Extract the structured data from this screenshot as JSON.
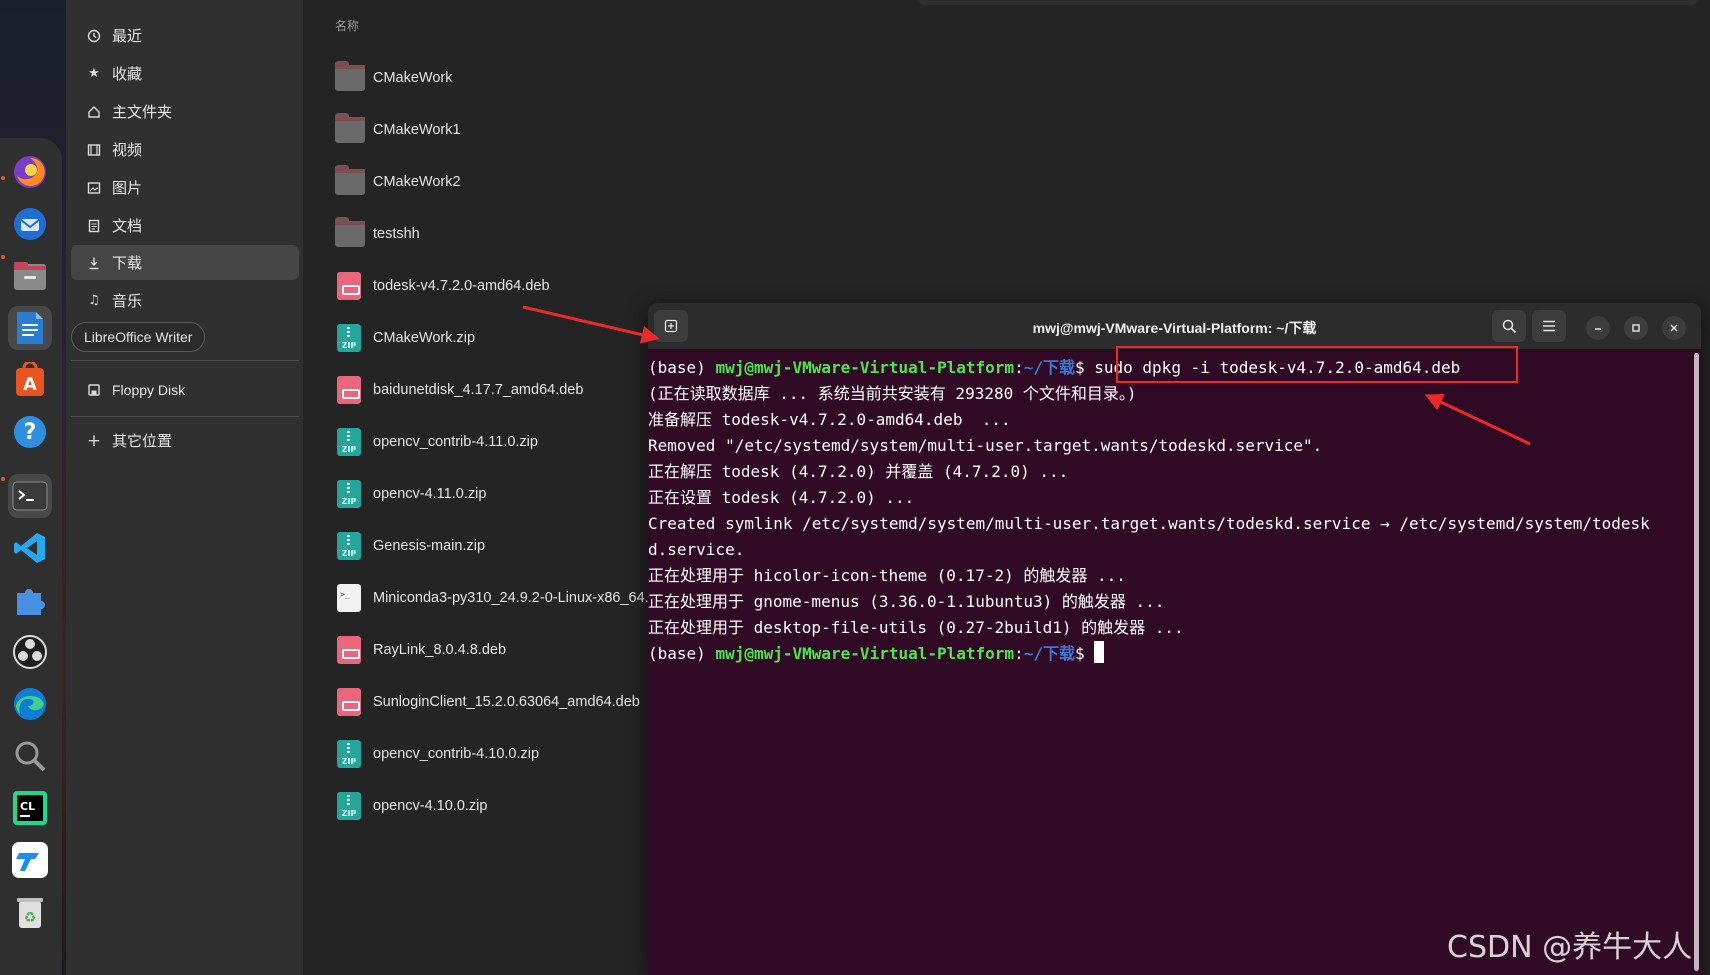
{
  "dock": {
    "apps": [
      {
        "name": "firefox",
        "icon": "firefox-icon"
      },
      {
        "name": "thunderbird",
        "icon": "thunderbird-icon"
      },
      {
        "name": "files",
        "icon": "files-icon"
      },
      {
        "name": "libreoffice-writer",
        "icon": "writer-icon"
      },
      {
        "name": "app-center",
        "icon": "app-center-icon"
      },
      {
        "name": "help",
        "icon": "help-icon"
      },
      {
        "name": "terminal",
        "icon": "terminal-icon"
      },
      {
        "name": "vscode",
        "icon": "vscode-icon"
      },
      {
        "name": "extensions",
        "icon": "puzzle-icon"
      },
      {
        "name": "obs",
        "icon": "obs-icon"
      },
      {
        "name": "edge",
        "icon": "edge-icon"
      },
      {
        "name": "search",
        "icon": "magnifier-icon"
      },
      {
        "name": "clion",
        "icon": "clion-icon"
      },
      {
        "name": "todesk",
        "icon": "todesk-icon"
      },
      {
        "name": "trash",
        "icon": "trash-icon"
      }
    ]
  },
  "sidebar": {
    "items": [
      {
        "label": "最近",
        "icon": "clock-icon"
      },
      {
        "label": "收藏",
        "icon": "star-icon"
      },
      {
        "label": "主文件夹",
        "icon": "home-icon"
      },
      {
        "label": "视频",
        "icon": "film-icon"
      },
      {
        "label": "图片",
        "icon": "image-icon"
      },
      {
        "label": "文档",
        "icon": "document-icon"
      },
      {
        "label": "下载",
        "icon": "download-icon"
      },
      {
        "label": "音乐",
        "icon": "music-icon"
      }
    ],
    "tooltip": "LibreOffice Writer",
    "devices": [
      {
        "label": "Floppy Disk",
        "icon": "floppy-icon"
      }
    ],
    "other": {
      "label": "其它位置",
      "icon": "plus-icon"
    }
  },
  "filelist": {
    "column_header": "名称",
    "files": [
      {
        "name": "CMakeWork",
        "type": "folder"
      },
      {
        "name": "CMakeWork1",
        "type": "folder"
      },
      {
        "name": "CMakeWork2",
        "type": "folder"
      },
      {
        "name": "testshh",
        "type": "folder"
      },
      {
        "name": "todesk-v4.7.2.0-amd64.deb",
        "type": "deb"
      },
      {
        "name": "CMakeWork.zip",
        "type": "zip"
      },
      {
        "name": "baidunetdisk_4.17.7_amd64.deb",
        "type": "deb"
      },
      {
        "name": "opencv_contrib-4.11.0.zip",
        "type": "zip"
      },
      {
        "name": "opencv-4.11.0.zip",
        "type": "zip"
      },
      {
        "name": "Genesis-main.zip",
        "type": "zip"
      },
      {
        "name": "Miniconda3-py310_24.9.2-0-Linux-x86_64.",
        "type": "sh"
      },
      {
        "name": "RayLink_8.0.4.8.deb",
        "type": "deb"
      },
      {
        "name": "SunloginClient_15.2.0.63064_amd64.deb",
        "type": "deb"
      },
      {
        "name": "opencv_contrib-4.10.0.zip",
        "type": "zip"
      },
      {
        "name": "opencv-4.10.0.zip",
        "type": "zip"
      }
    ],
    "zip_badge": "ZIP"
  },
  "terminal": {
    "title": "mwj@mwj-VMware-Virtual-Platform: ~/下载",
    "prompt": {
      "env": "(base) ",
      "user_host": "mwj@mwj-VMware-Virtual-Platform",
      "sep": ":",
      "path": "~/下载",
      "dollar": "$ "
    },
    "command": "sudo dpkg -i todesk-v4.7.2.0-amd64.deb",
    "output": [
      "(正在读取数据库 ... 系统当前共安装有 293280 个文件和目录。)",
      "准备解压 todesk-v4.7.2.0-amd64.deb  ...",
      "Removed \"/etc/systemd/system/multi-user.target.wants/todeskd.service\".",
      "正在解压 todesk (4.7.2.0) 并覆盖 (4.7.2.0) ...",
      "正在设置 todesk (4.7.2.0) ...",
      "Created symlink /etc/systemd/system/multi-user.target.wants/todeskd.service → /etc/systemd/system/todesk",
      "d.service.",
      "正在处理用于 hicolor-icon-theme (0.17-2) 的触发器 ...",
      "正在处理用于 gnome-menus (3.36.0-1.1ubuntu3) 的触发器 ...",
      "正在处理用于 desktop-file-utils (0.27-2build1) 的触发器 ..."
    ],
    "colors": {
      "background": "#300a24",
      "user_host": "#4ce64c",
      "path": "#3c78d8"
    }
  },
  "annotation": {
    "color": "#ea2a2a"
  },
  "watermark": "CSDN @养牛大人"
}
